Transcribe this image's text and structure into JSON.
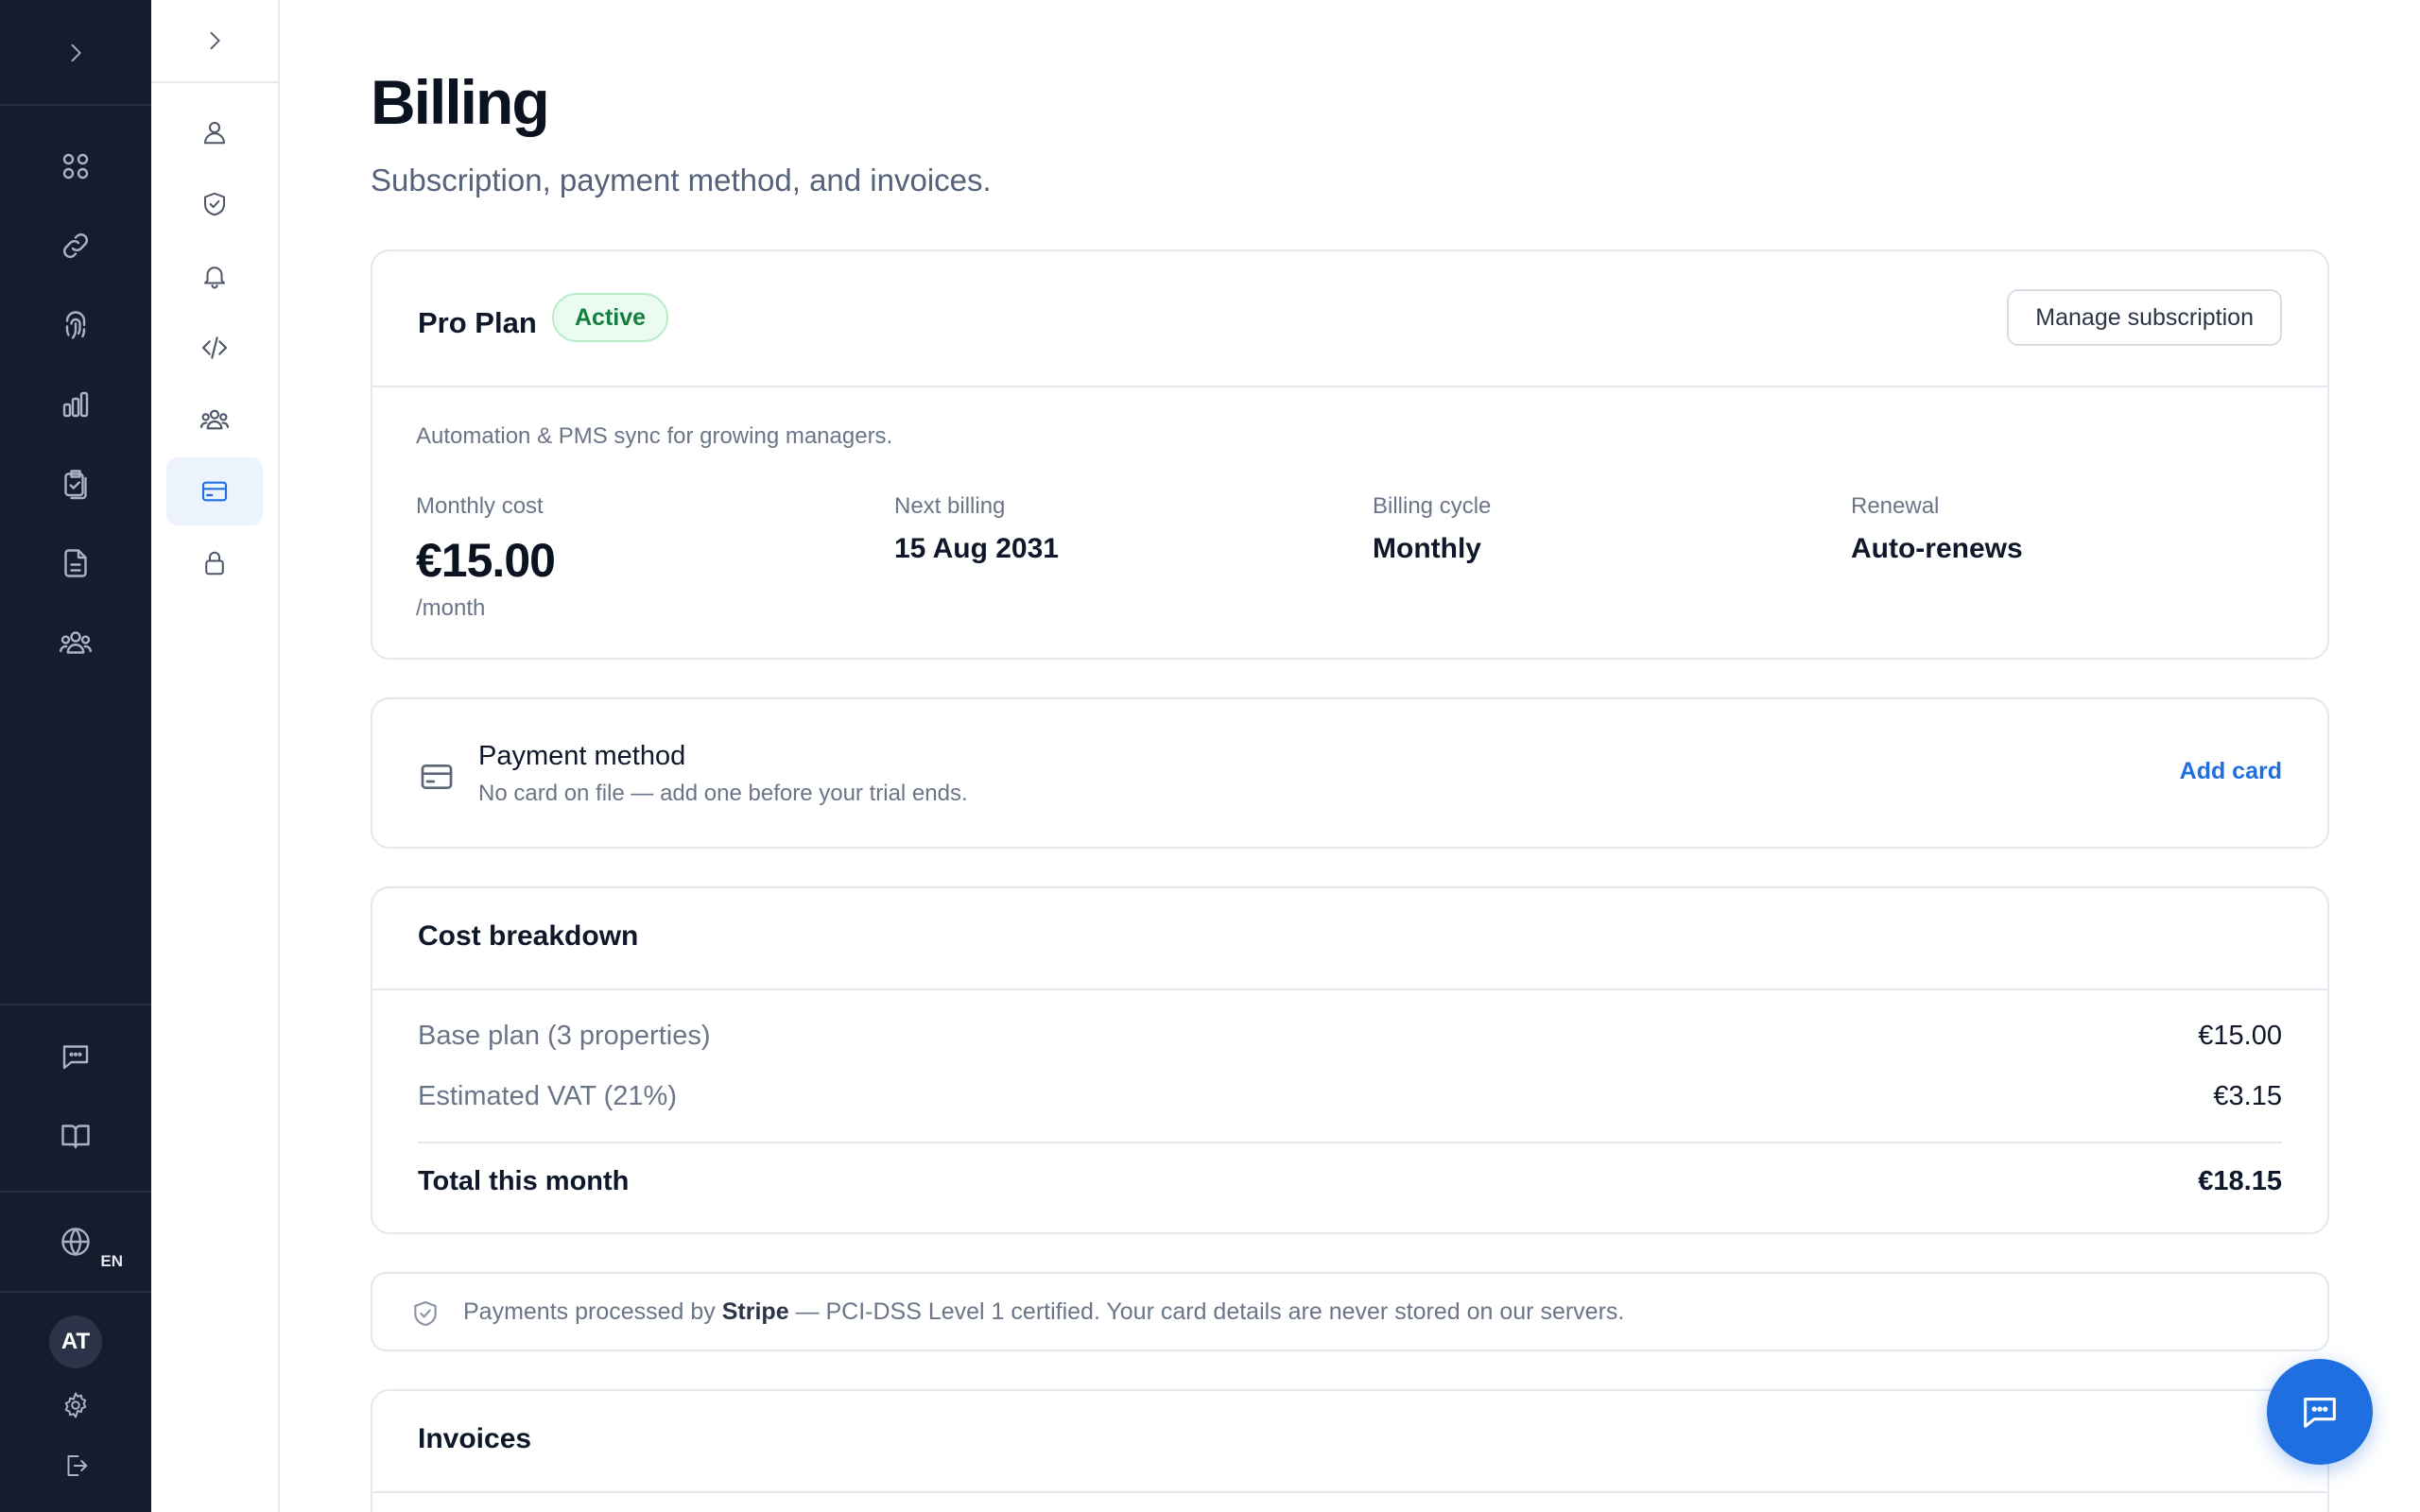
{
  "rail": {
    "expand_icon": "chevron-right-icon",
    "items": [
      {
        "icon": "grid-icon"
      },
      {
        "icon": "link-icon"
      },
      {
        "icon": "fingerprint-icon"
      },
      {
        "icon": "bar-chart-icon"
      },
      {
        "icon": "clipboard-check-icon"
      },
      {
        "icon": "document-icon"
      },
      {
        "icon": "users-icon"
      }
    ],
    "bottom_items": [
      {
        "icon": "chat-icon"
      },
      {
        "icon": "book-icon"
      }
    ],
    "language": "EN",
    "avatar_initials": "AT"
  },
  "subnav": {
    "items": [
      {
        "icon": "user-icon"
      },
      {
        "icon": "shield-check-icon"
      },
      {
        "icon": "bell-icon"
      },
      {
        "icon": "code-icon"
      },
      {
        "icon": "team-icon"
      },
      {
        "icon": "credit-card-icon",
        "active": true
      },
      {
        "icon": "lock-icon"
      }
    ]
  },
  "page": {
    "title": "Billing",
    "subtitle": "Subscription, payment method, and invoices."
  },
  "plan": {
    "name": "Pro Plan",
    "status": "Active",
    "manage_label": "Manage subscription",
    "description": "Automation & PMS sync for growing managers.",
    "monthly_cost_label": "Monthly cost",
    "monthly_cost": "€15.00",
    "monthly_unit": "/month",
    "next_billing_label": "Next billing",
    "next_billing": "15 Aug 2031",
    "cycle_label": "Billing cycle",
    "cycle": "Monthly",
    "renewal_label": "Renewal",
    "renewal": "Auto-renews"
  },
  "payment": {
    "title": "Payment method",
    "subtitle": "No card on file — add one before your trial ends.",
    "add_label": "Add card"
  },
  "breakdown": {
    "title": "Cost breakdown",
    "rows": [
      {
        "label": "Base plan (3 properties)",
        "value": "€15.00"
      },
      {
        "label": "Estimated VAT (21%)",
        "value": "€3.15"
      }
    ],
    "total_label": "Total this month",
    "total_value": "€18.15"
  },
  "notice": {
    "prefix": "Payments processed by ",
    "provider": "Stripe",
    "suffix": " — PCI-DSS Level 1 certified. Your card details are never stored on our servers."
  },
  "invoices": {
    "title": "Invoices"
  },
  "colors": {
    "rail_bg": "#151c2e",
    "accent": "#1f6fe0",
    "active_green": "#15803d"
  }
}
